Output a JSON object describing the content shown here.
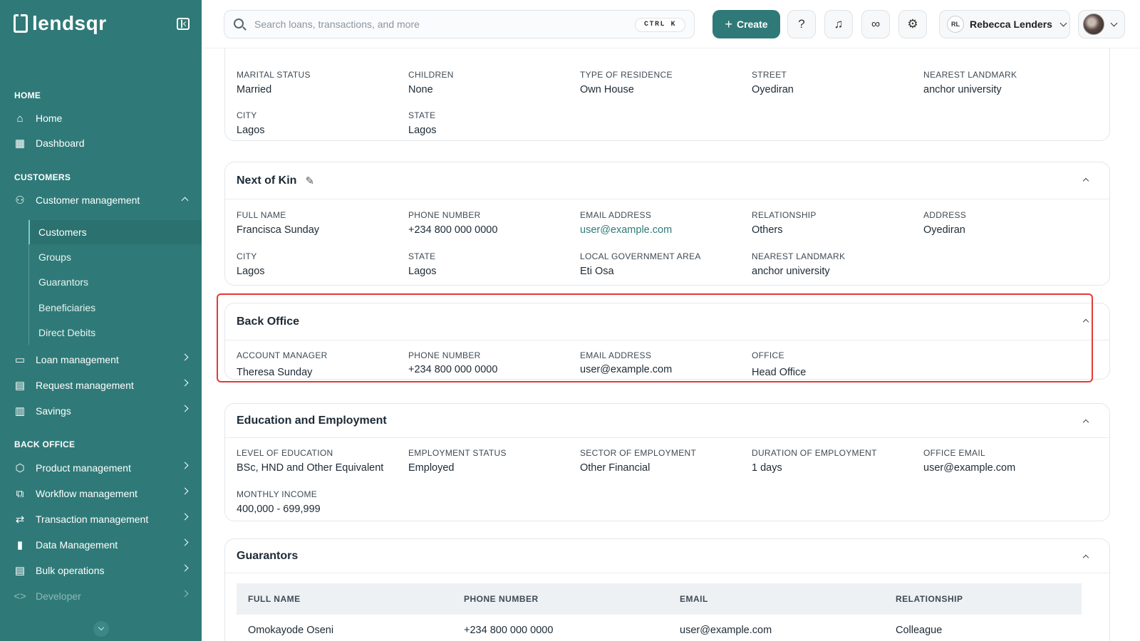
{
  "brand": {
    "name": "lendsqr"
  },
  "sidebar": {
    "sections": [
      {
        "title": "HOME"
      },
      {
        "title": "CUSTOMERS"
      },
      {
        "title": "BACK OFFICE"
      }
    ],
    "home_items": [
      {
        "label": "Home",
        "icon": "home-icon"
      },
      {
        "label": "Dashboard",
        "icon": "dashboard-icon"
      }
    ],
    "customer_management": {
      "label": "Customer management",
      "sub_items": [
        "Customers",
        "Groups",
        "Guarantors",
        "Beneficiaries",
        "Direct Debits"
      ]
    },
    "customer_items": [
      {
        "label": "Loan management"
      },
      {
        "label": "Request management"
      },
      {
        "label": "Savings"
      }
    ],
    "back_office_items": [
      {
        "label": "Product management"
      },
      {
        "label": "Workflow management"
      },
      {
        "label": "Transaction management"
      },
      {
        "label": "Data Management"
      },
      {
        "label": "Bulk operations"
      },
      {
        "label": "Developer"
      }
    ]
  },
  "topbar": {
    "search_placeholder": "Search loans, transactions, and more",
    "shortcut": "CTRL K",
    "create_label": "Create",
    "user_initials": "RL",
    "user_name": "Rebecca Lenders"
  },
  "personal": {
    "fields": [
      {
        "label": "MARITAL STATUS",
        "value": "Married"
      },
      {
        "label": "CHILDREN",
        "value": "None"
      },
      {
        "label": "TYPE OF RESIDENCE",
        "value": "Own House"
      },
      {
        "label": "STREET",
        "value": "Oyediran"
      },
      {
        "label": "NEAREST LANDMARK",
        "value": "anchor university"
      },
      {
        "label": "CITY",
        "value": "Lagos"
      },
      {
        "label": "STATE",
        "value": "Lagos"
      }
    ]
  },
  "next_of_kin": {
    "title": "Next of Kin",
    "fields": [
      {
        "label": "FULL NAME",
        "value": "Francisca Sunday"
      },
      {
        "label": "PHONE NUMBER",
        "value": "+234 800 000 0000"
      },
      {
        "label": "EMAIL ADDRESS",
        "value": "user@example.com"
      },
      {
        "label": "RELATIONSHIP",
        "value": "Others"
      },
      {
        "label": "ADDRESS",
        "value": "Oyediran"
      },
      {
        "label": "CITY",
        "value": "Lagos"
      },
      {
        "label": "STATE",
        "value": "Lagos"
      },
      {
        "label": "LOCAL GOVERNMENT AREA",
        "value": "Eti Osa"
      },
      {
        "label": "NEAREST LANDMARK",
        "value": "anchor university"
      }
    ]
  },
  "back_office": {
    "title": "Back Office",
    "fields": [
      {
        "label": "ACCOUNT MANAGER",
        "value": "Theresa Sunday"
      },
      {
        "label": "PHONE NUMBER",
        "value": "+234 800 000 0000"
      },
      {
        "label": "EMAIL ADDRESS",
        "value": "user@example.com"
      },
      {
        "label": "OFFICE",
        "value": "Head Office"
      }
    ]
  },
  "education": {
    "title": "Education and Employment",
    "fields": [
      {
        "label": "LEVEL OF EDUCATION",
        "value": "BSc, HND and Other Equivalent"
      },
      {
        "label": "EMPLOYMENT STATUS",
        "value": "Employed"
      },
      {
        "label": "SECTOR OF EMPLOYMENT",
        "value": "Other Financial"
      },
      {
        "label": "DURATION OF EMPLOYMENT",
        "value": "1 days"
      },
      {
        "label": "OFFICE EMAIL",
        "value": "user@example.com"
      },
      {
        "label": "MONTHLY INCOME",
        "value": "400,000 - 699,999"
      }
    ]
  },
  "guarantors": {
    "title": "Guarantors",
    "columns": [
      "FULL NAME",
      "PHONE NUMBER",
      "EMAIL",
      "RELATIONSHIP"
    ],
    "rows": [
      [
        "Omokayode Oseni",
        "+234 800 000 0000",
        "user@example.com",
        "Colleague"
      ]
    ]
  }
}
